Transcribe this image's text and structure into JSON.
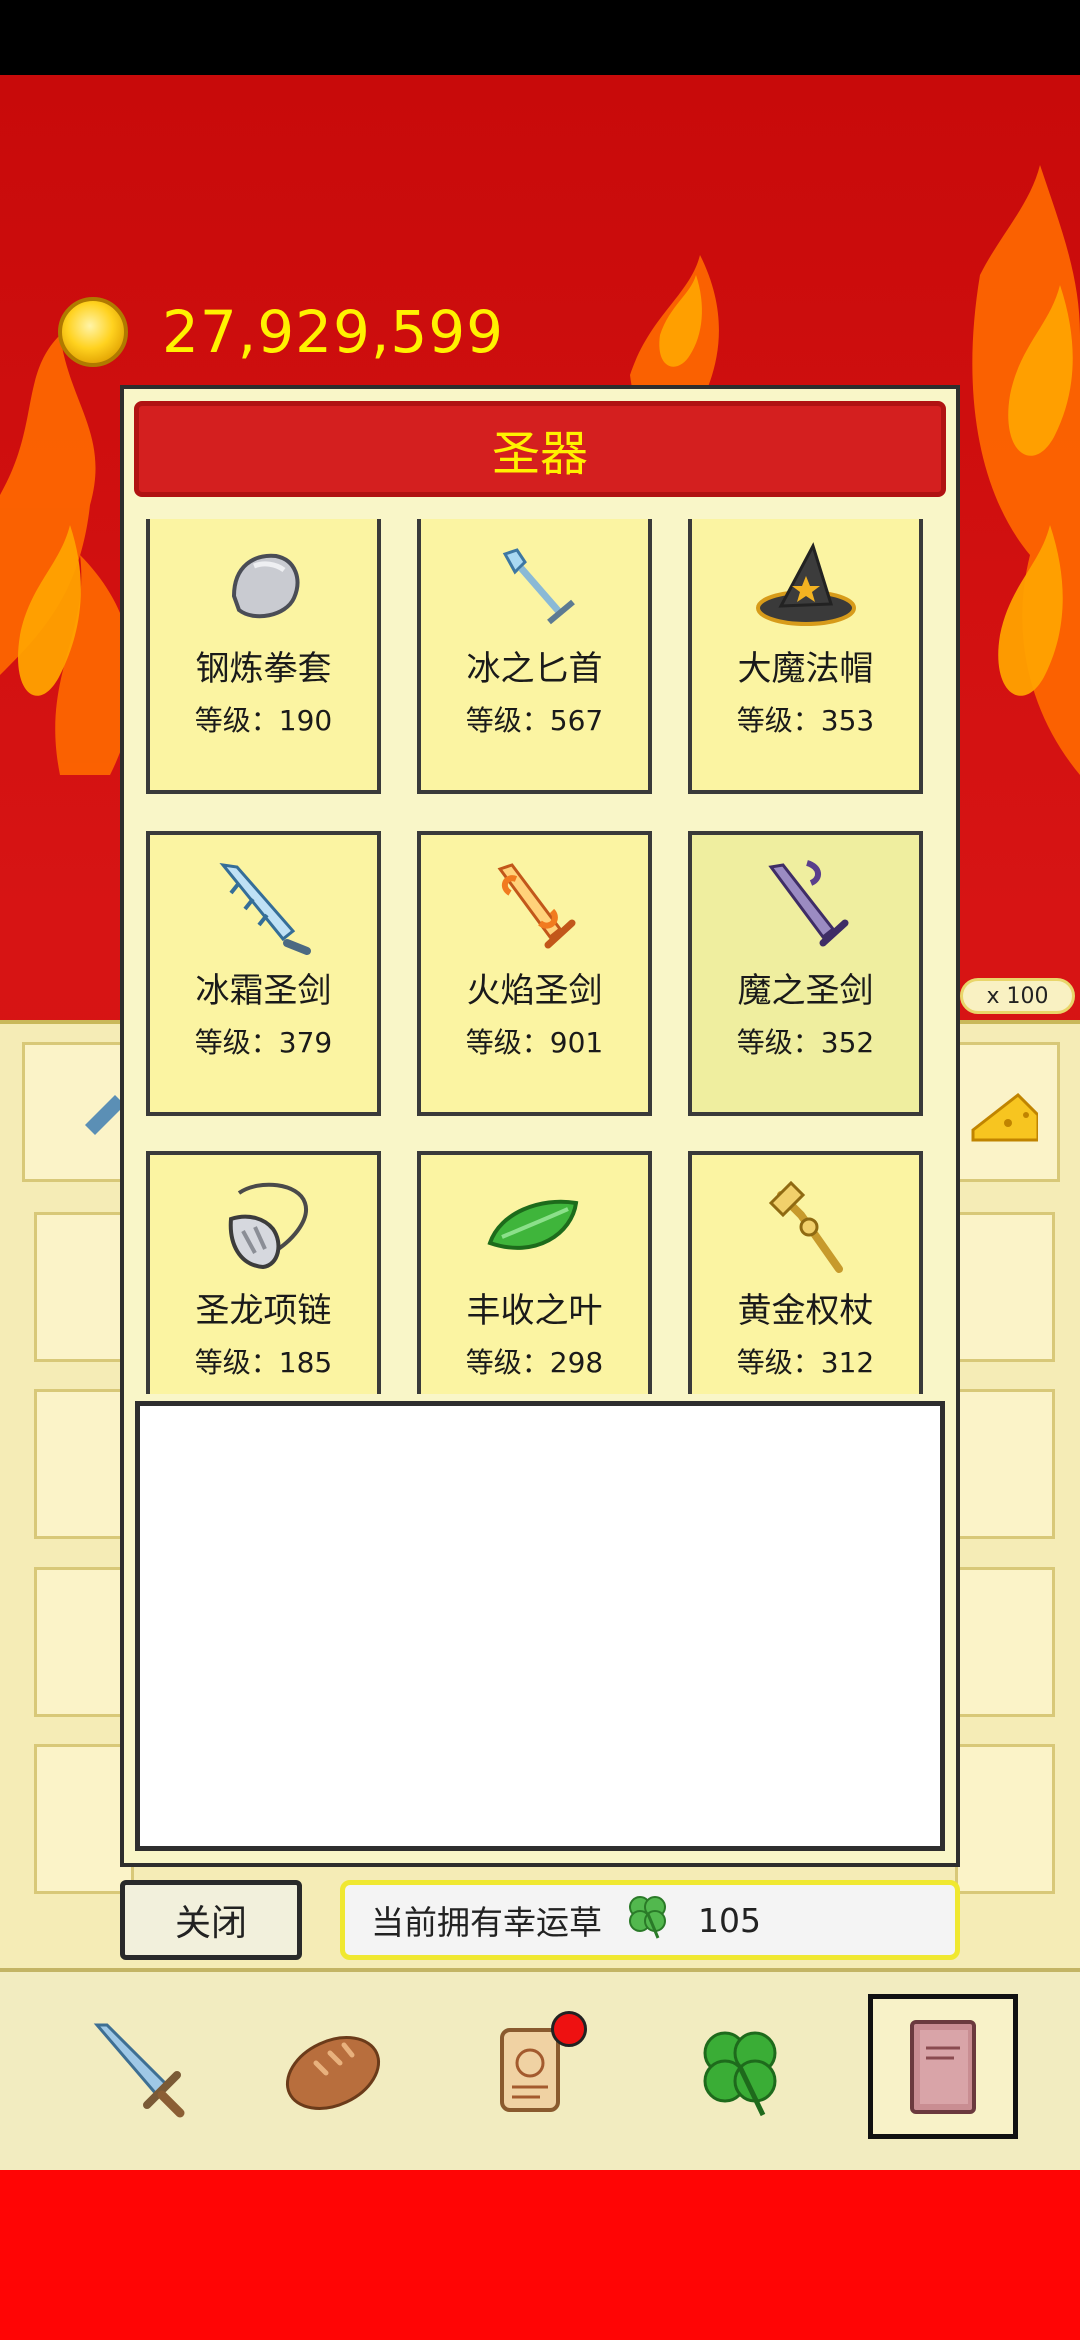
{
  "header": {
    "coin_amount": "27,929,599",
    "coin_icon": "gold-coin-icon"
  },
  "modal": {
    "title": "圣器",
    "artifacts": [
      {
        "name": "钢炼拳套",
        "level": "等级：190",
        "icon": "steel-gauntlet-icon"
      },
      {
        "name": "冰之匕首",
        "level": "等级：567",
        "icon": "ice-dagger-icon"
      },
      {
        "name": "大魔法帽",
        "level": "等级：353",
        "icon": "wizard-hat-icon"
      },
      {
        "name": "冰霜圣剑",
        "level": "等级：379",
        "icon": "frost-sword-icon"
      },
      {
        "name": "火焰圣剑",
        "level": "等级：901",
        "icon": "flame-sword-icon"
      },
      {
        "name": "魔之圣剑",
        "level": "等级：352",
        "icon": "demon-sword-icon"
      },
      {
        "name": "圣龙项链",
        "level": "等级：185",
        "icon": "dragon-necklace-icon"
      },
      {
        "name": "丰收之叶",
        "level": "等级：298",
        "icon": "harvest-leaf-icon"
      },
      {
        "name": "黄金权杖",
        "level": "等级：312",
        "icon": "golden-scepter-icon"
      }
    ],
    "description": ""
  },
  "footer": {
    "close_label": "关闭",
    "clover_label": "当前拥有幸运草",
    "clover_count": "105"
  },
  "under_panel": {
    "multiplier": "x 100"
  },
  "nav": {
    "items": [
      "sword-icon",
      "bread-icon",
      "scroll-icon",
      "clover-icon",
      "book-icon"
    ],
    "active_index": 4
  },
  "colors": {
    "title_red": "#d41f1f",
    "title_text": "#fff200",
    "coin_text": "#fff200",
    "card_bg": "#fbf4a2"
  }
}
